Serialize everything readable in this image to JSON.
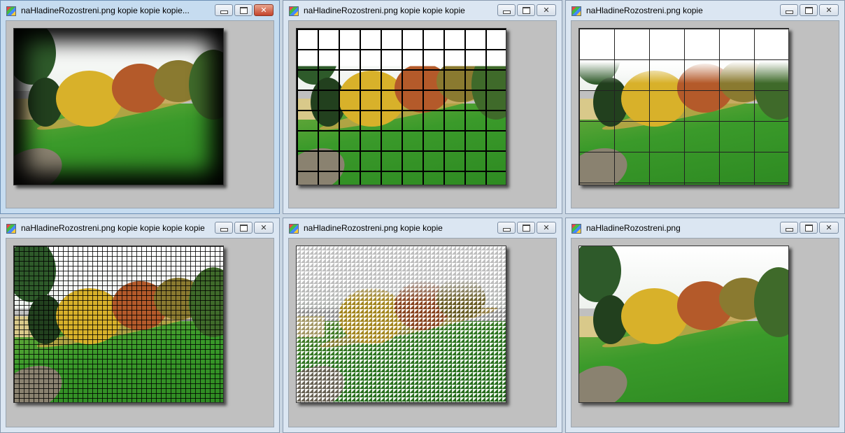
{
  "windows": [
    {
      "title": "naHladineRozostreni.png kopie kopie kopie...",
      "effect": "vignette"
    },
    {
      "title": "naHladineRozostreni.png kopie kopie kopie",
      "effect": "tiles"
    },
    {
      "title": "naHladineRozostreni.png kopie",
      "effect": "puzzle"
    },
    {
      "title": "naHladineRozostreni.png kopie kopie kopie kopie",
      "effect": "pixelate"
    },
    {
      "title": "naHladineRozostreni.png kopie kopie",
      "effect": "triangles"
    },
    {
      "title": "naHladineRozostreni.png",
      "effect": "original"
    }
  ],
  "controls": {
    "minimize": "",
    "maximize": "",
    "close": "✕"
  },
  "colors": {
    "client_bg": "#c0c0c0",
    "active_close": "#c4432b"
  }
}
